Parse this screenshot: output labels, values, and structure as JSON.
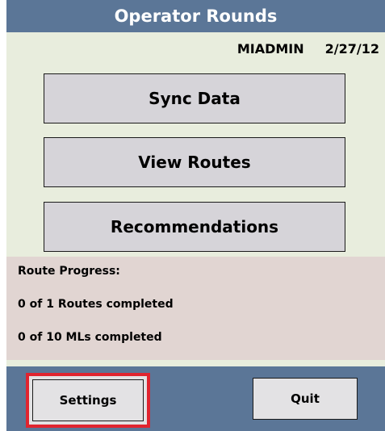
{
  "window": {
    "title": "Operator Rounds"
  },
  "user": {
    "name": "MIADMIN",
    "date": "2/27/12"
  },
  "menu": {
    "sync_label": "Sync Data",
    "routes_label": "View Routes",
    "recommendations_label": "Recommendations"
  },
  "progress": {
    "title": "Route Progress:",
    "routes_text": "0 of 1 Routes completed",
    "mls_text": "0 of 10 MLs completed"
  },
  "footer": {
    "settings_label": "Settings",
    "quit_label": "Quit"
  },
  "colors": {
    "header": "#5b7697",
    "background": "#e8eddd",
    "progress_panel": "#e1d5d2",
    "highlight": "#e0242f"
  }
}
